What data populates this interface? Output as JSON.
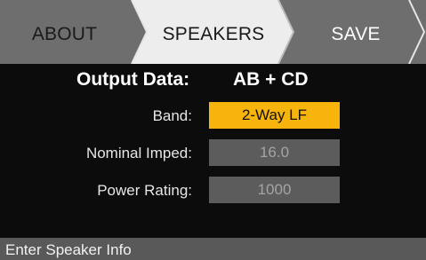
{
  "tabs": [
    {
      "label": "ABOUT",
      "state": "inactive"
    },
    {
      "label": "SPEAKERS",
      "state": "active"
    },
    {
      "label": "SAVE",
      "state": "inactive"
    }
  ],
  "output": {
    "label": "Output Data:",
    "value": "AB + CD"
  },
  "fields": {
    "band": {
      "label": "Band:",
      "value": "2-Way LF",
      "state": "selected"
    },
    "nominal_imped": {
      "label": "Nominal Imped:",
      "value": "16.0",
      "state": "disabled"
    },
    "power_rating": {
      "label": "Power Rating:",
      "value": "1000",
      "state": "disabled"
    }
  },
  "status": "Enter Speaker Info",
  "colors": {
    "tab_inactive": "#6e6e6e",
    "tab_active": "#ededed",
    "background": "#0c0c0c",
    "highlight": "#f6b40d",
    "field_disabled": "#5c5c5c",
    "status_bar": "#595959"
  }
}
